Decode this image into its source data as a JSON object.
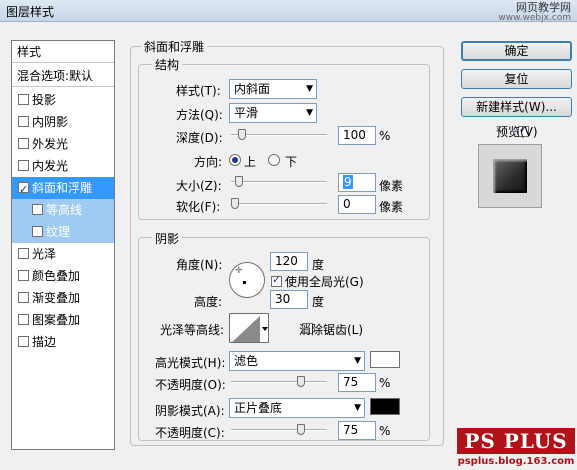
{
  "window": {
    "title": "图层样式"
  },
  "watermark": {
    "line1": "网页教学网",
    "line2": "www.webjx.com"
  },
  "style_list": {
    "header": "样式",
    "blend_options": "混合选项:默认",
    "items": [
      {
        "label": "投影",
        "checked": false
      },
      {
        "label": "内阴影",
        "checked": false
      },
      {
        "label": "外发光",
        "checked": false
      },
      {
        "label": "内发光",
        "checked": false
      },
      {
        "label": "斜面和浮雕",
        "checked": true,
        "selected": true
      },
      {
        "label": "等高线",
        "checked": false,
        "sub": true
      },
      {
        "label": "纹理",
        "checked": false,
        "sub": true
      },
      {
        "label": "光泽",
        "checked": false
      },
      {
        "label": "颜色叠加",
        "checked": false
      },
      {
        "label": "渐变叠加",
        "checked": false
      },
      {
        "label": "图案叠加",
        "checked": false
      },
      {
        "label": "描边",
        "checked": false
      }
    ]
  },
  "bevel": {
    "section_title": "斜面和浮雕",
    "structure": {
      "title": "结构",
      "style_label": "样式(T):",
      "style_value": "内斜面",
      "technique_label": "方法(Q):",
      "technique_value": "平滑",
      "depth_label": "深度(D):",
      "depth_value": "100",
      "depth_unit": "%",
      "depth_slider": 0.08,
      "direction_label": "方向:",
      "dir_up": "上",
      "dir_down": "下",
      "direction_selected": "up",
      "size_label": "大小(Z):",
      "size_value": "9",
      "size_unit": "像素",
      "size_slider": 0.04,
      "soften_label": "软化(F):",
      "soften_value": "0",
      "soften_unit": "像素",
      "soften_slider": 0
    },
    "shading": {
      "title": "阴影",
      "angle_label": "角度(N):",
      "angle_value": "120",
      "angle_unit": "度",
      "global_light_label": "使用全局光(G)",
      "global_light_checked": true,
      "altitude_label": "高度:",
      "altitude_value": "30",
      "altitude_unit": "度",
      "gloss_contour_label": "光泽等高线:",
      "antialias_label": "消除锯齿(L)",
      "antialias_checked": false,
      "highlight_mode_label": "高光模式(H):",
      "highlight_mode_value": "滤色",
      "highlight_color": "#ffffff",
      "highlight_opacity_label": "不透明度(O):",
      "highlight_opacity_value": "75",
      "highlight_opacity_unit": "%",
      "highlight_opacity_slider": 0.75,
      "shadow_mode_label": "阴影模式(A):",
      "shadow_mode_value": "正片叠底",
      "shadow_color": "#000000",
      "shadow_opacity_label": "不透明度(C):",
      "shadow_opacity_value": "75",
      "shadow_opacity_unit": "%",
      "shadow_opacity_slider": 0.75
    }
  },
  "buttons": {
    "ok": "确定",
    "reset": "复位",
    "new_style": "新建样式(W)..."
  },
  "preview": {
    "label": "预览(V)",
    "checked": true
  },
  "logo": {
    "text": "PS PLUS",
    "subtext": "psplus.blog.163.com"
  }
}
